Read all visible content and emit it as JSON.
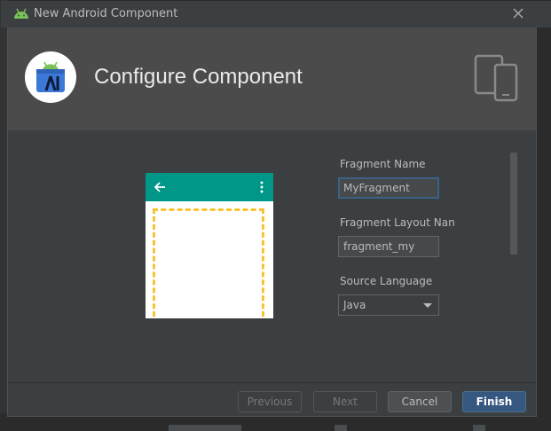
{
  "window": {
    "title": "New Android Component",
    "icons": {
      "app": "android-icon",
      "close": "close-icon"
    }
  },
  "header": {
    "heading": "Configure Component",
    "logo_icon": "android-studio-logo-icon",
    "devices_icon": "tablet-phone-icon"
  },
  "preview": {
    "appbar_color": "#009688",
    "placeholder_color": "#f6c431",
    "back_icon": "arrow-back-icon",
    "menu_icon": "more-vert-icon"
  },
  "form": {
    "fragment_name": {
      "label": "Fragment Name",
      "value": "MyFragment"
    },
    "layout_name": {
      "label": "Fragment Layout Nan",
      "value": "fragment_my"
    },
    "source_language": {
      "label": "Source Language",
      "value": "Java"
    }
  },
  "buttons": {
    "previous": "Previous",
    "next": "Next",
    "cancel": "Cancel",
    "finish": "Finish"
  },
  "colors": {
    "dialog_bg": "#3c3f41",
    "header_bg": "#4b4b4b",
    "accent": "#365880"
  }
}
